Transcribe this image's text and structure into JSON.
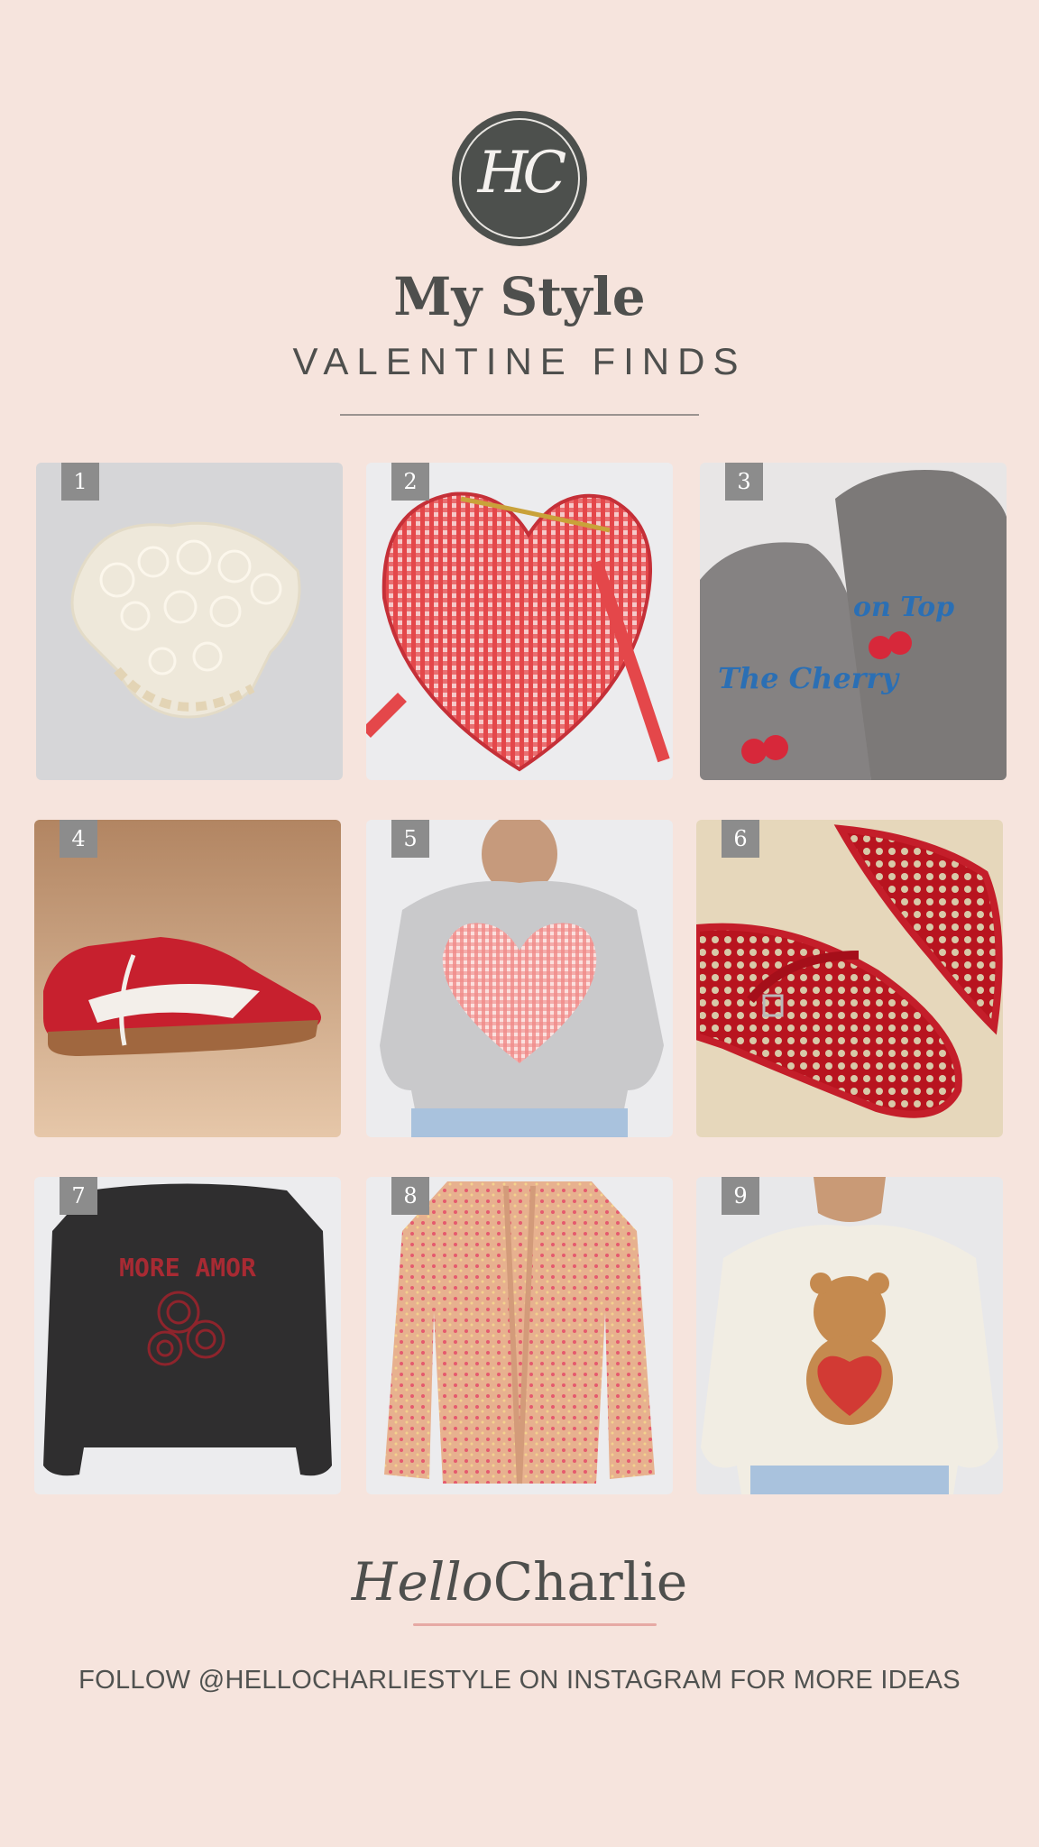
{
  "header": {
    "logo_monogram": "HC",
    "title": "My Style",
    "subtitle": "VALENTINE FINDS"
  },
  "products": [
    {
      "number": "1",
      "icon": "hair-claw-clip-image"
    },
    {
      "number": "2",
      "icon": "heart-gingham-bag-image"
    },
    {
      "number": "3",
      "icon": "cherry-socks-image",
      "print_text": "The Cherry on Top"
    },
    {
      "number": "4",
      "icon": "red-sneaker-image"
    },
    {
      "number": "5",
      "icon": "heart-sweatshirt-image"
    },
    {
      "number": "6",
      "icon": "red-mesh-flats-image"
    },
    {
      "number": "7",
      "icon": "more-amor-sweatshirt-image",
      "print_text": "MORE AMOR"
    },
    {
      "number": "8",
      "icon": "pink-cardigan-image"
    },
    {
      "number": "9",
      "icon": "teddy-bear-sweatshirt-image"
    }
  ],
  "footer": {
    "brand_hello": "Hello",
    "brand_charlie": "Charlie",
    "follow_text": "FOLLOW @HELLOCHARLIESTYLE ON INSTAGRAM FOR MORE IDEAS"
  },
  "colors": {
    "background": "#f6e4dd",
    "text": "#4e4f4d",
    "badge": "#8c8c8c",
    "accent_red": "#c8222f"
  }
}
